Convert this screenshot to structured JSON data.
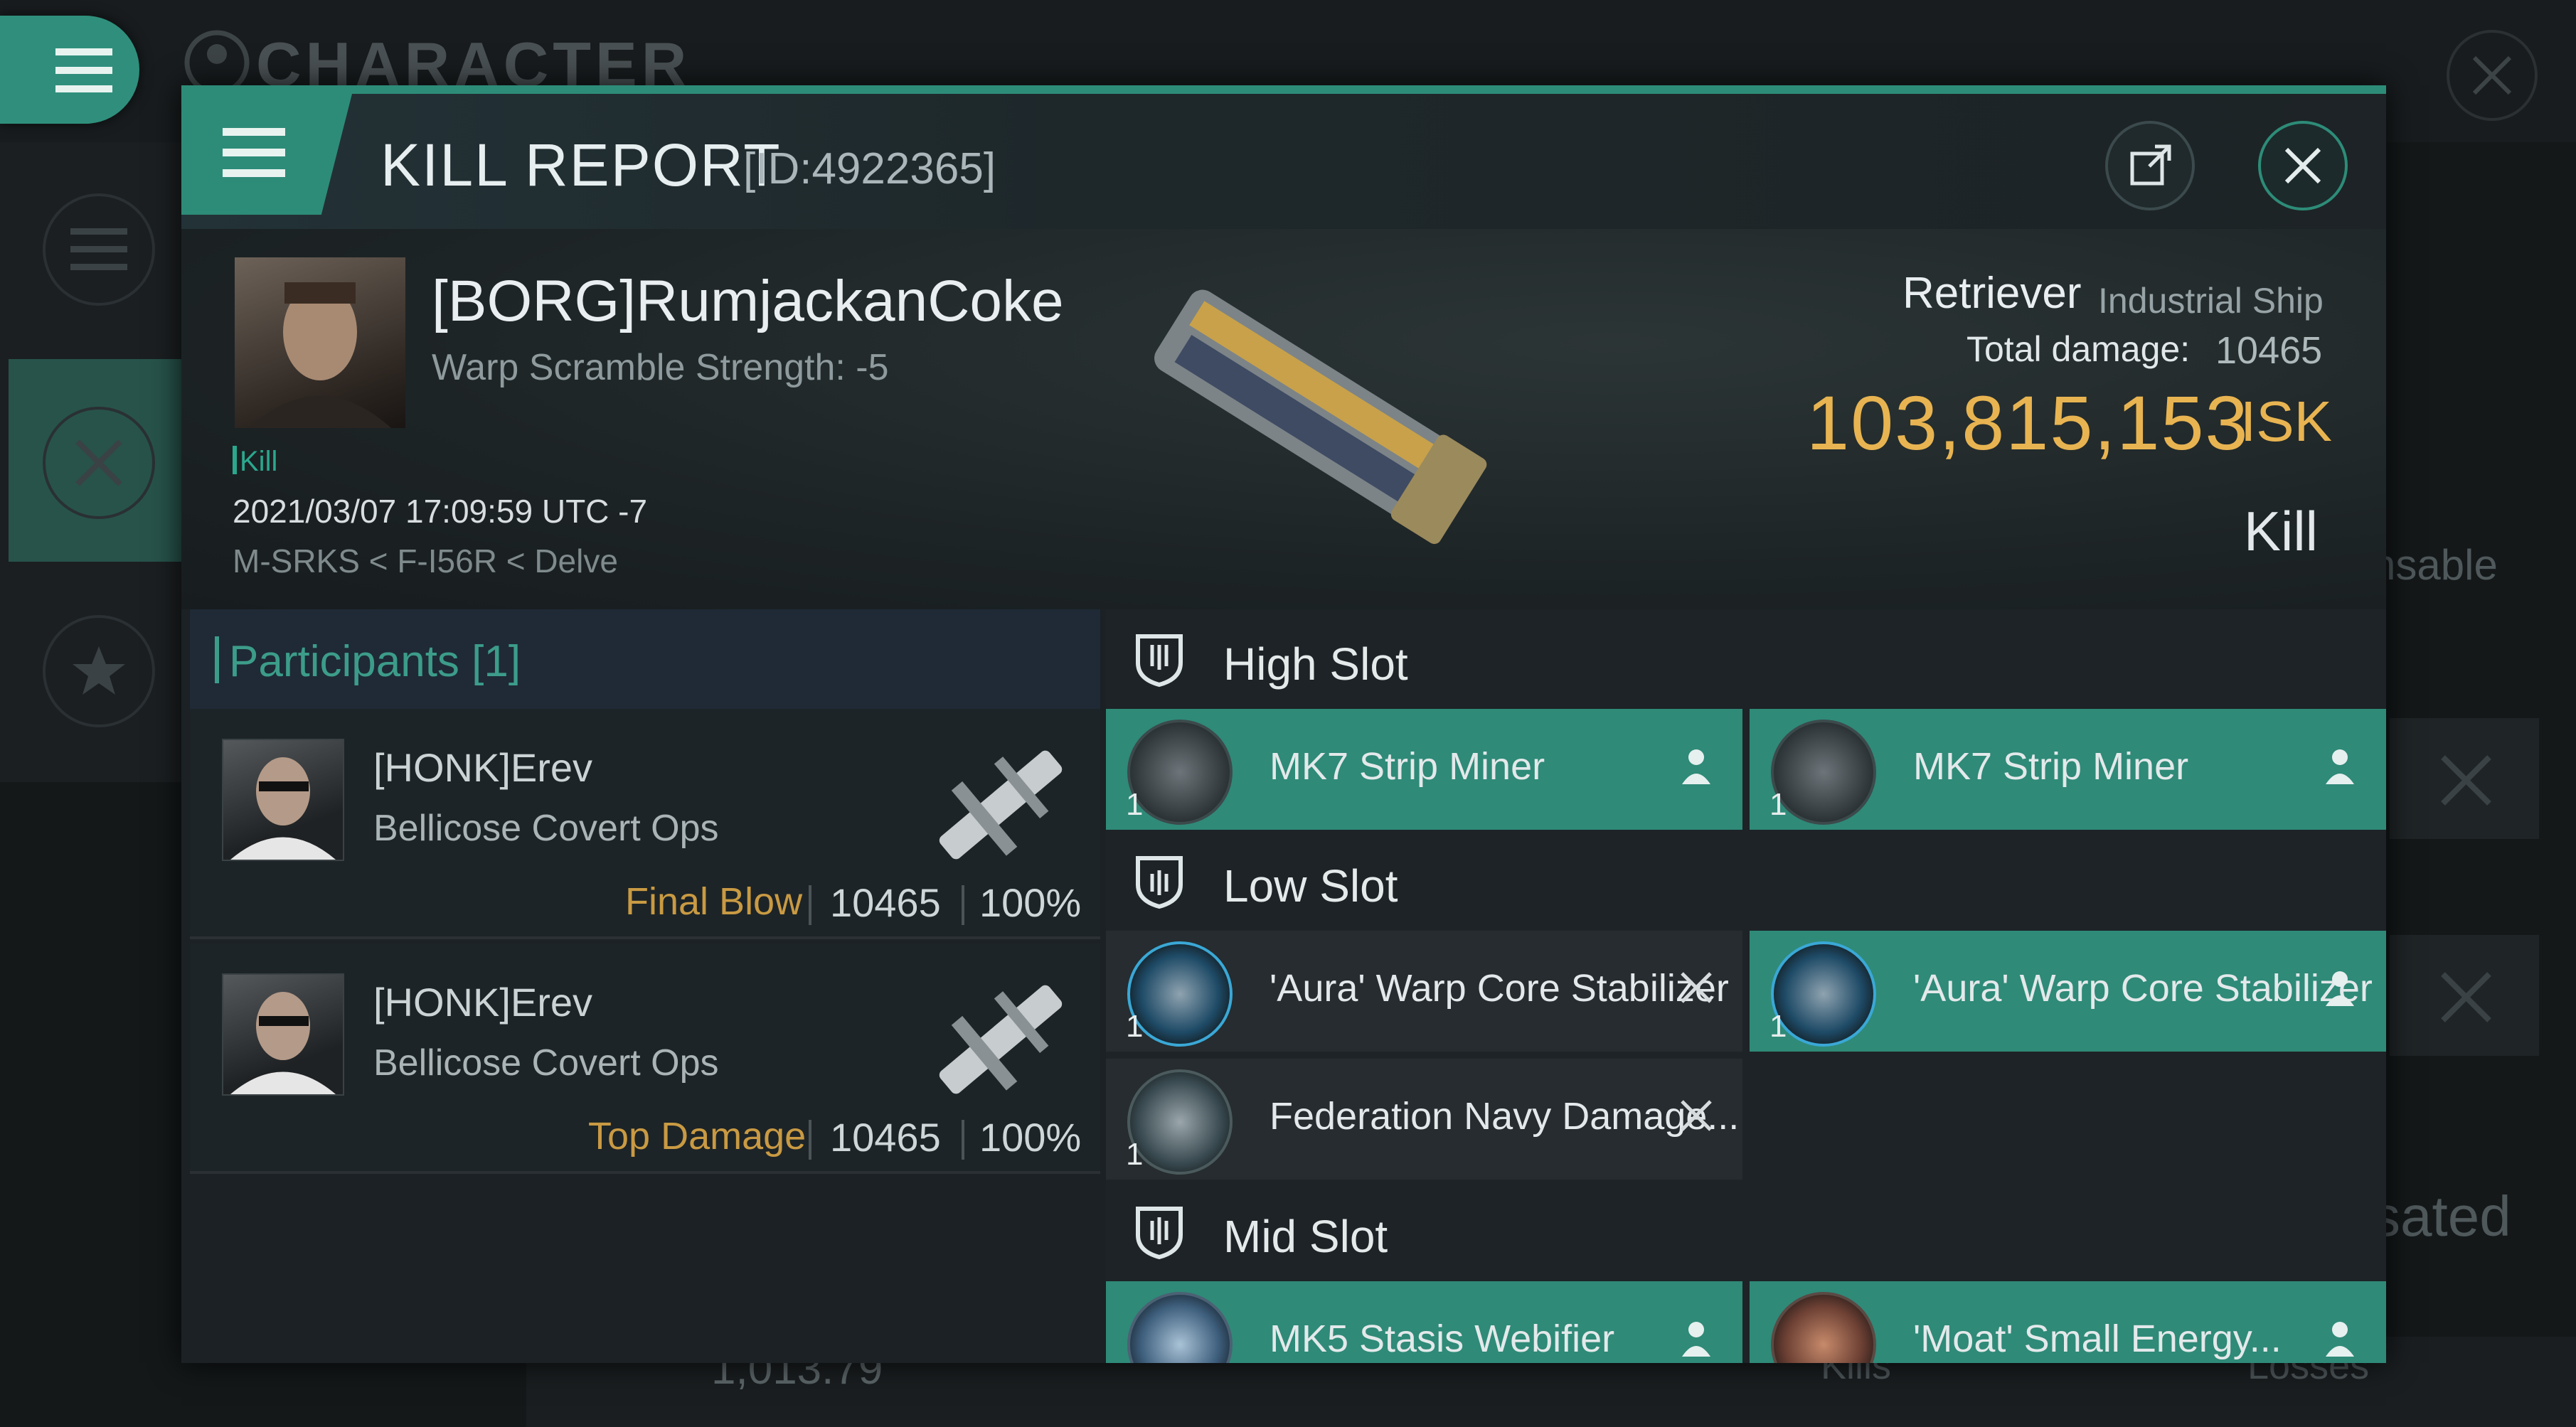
{
  "background": {
    "title": "CHARACTER",
    "wallet_isk": "1,013.79",
    "kills_label": "Kills",
    "losses_label": "Losses",
    "right_text_1": "nsable",
    "right_text_2": "sated"
  },
  "panel": {
    "title": "KILL REPORT",
    "report_id": "[ID:4922365]"
  },
  "victim": {
    "name": "[BORG]RumjackanCoke",
    "warp_scramble": "Warp Scramble Strength: -5",
    "tag": "Kill",
    "timestamp": "2021/03/07 17:09:59 UTC -7",
    "location": "M-SRKS < F-I56R < Delve",
    "ship_name": "Retriever",
    "ship_class": "Industrial Ship",
    "total_damage_label": "Total damage:",
    "total_damage": "10465",
    "isk_value": "103,815,153",
    "isk_unit": "ISK",
    "result": "Kill"
  },
  "participants": {
    "title": "Participants [1]",
    "cards": [
      {
        "name": "[HONK]Erev",
        "ship": "Bellicose Covert Ops",
        "role": "Final Blow",
        "damage": "10465",
        "percent": "100%"
      },
      {
        "name": "[HONK]Erev",
        "ship": "Bellicose Covert Ops",
        "role": "Top Damage",
        "damage": "10465",
        "percent": "100%"
      }
    ]
  },
  "slots": {
    "high": {
      "title": "High Slot",
      "modules": [
        {
          "name": "MK7 Strip Miner",
          "qty": "1",
          "status": "person-icon"
        },
        {
          "name": "MK7 Strip Miner",
          "qty": "1",
          "status": "person-icon"
        }
      ]
    },
    "low": {
      "title": "Low Slot",
      "modules": [
        {
          "name": "'Aura' Warp Core Stabilizer",
          "qty": "1",
          "status": "destroyed-x-icon"
        },
        {
          "name": "'Aura' Warp Core Stabilizer",
          "qty": "1",
          "status": "person-icon"
        },
        {
          "name": "Federation Navy Damage...",
          "qty": "1",
          "status": "destroyed-x-icon"
        }
      ]
    },
    "mid": {
      "title": "Mid Slot",
      "modules": [
        {
          "name": "MK5 Stasis Webifier",
          "qty": "1",
          "status": "person-icon"
        },
        {
          "name": "'Moat' Small Energy...",
          "qty": "1",
          "status": "person-icon"
        }
      ]
    }
  },
  "colors": {
    "accent": "#2d8c78",
    "isk": "#e8b451",
    "final_blow": "#c99a43"
  }
}
